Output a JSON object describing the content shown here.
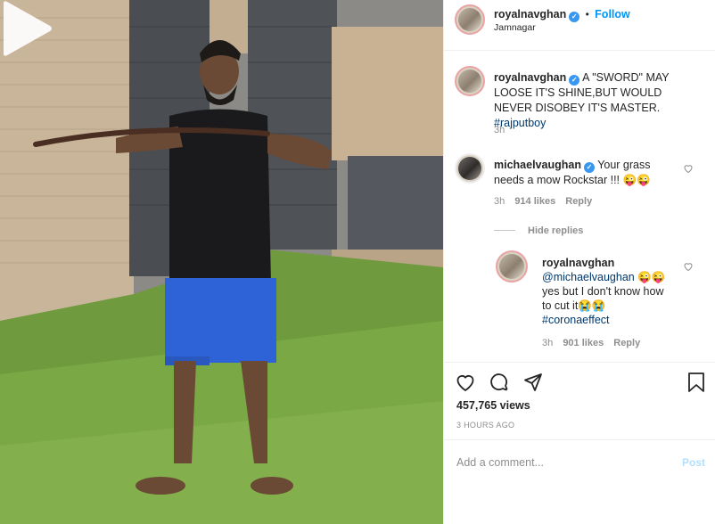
{
  "header": {
    "username": "royalnavghan",
    "follow_label": "Follow",
    "location": "Jamnagar",
    "separator": "•"
  },
  "caption": {
    "username": "royalnavghan",
    "text": "A \"SWORD\" MAY LOOSE IT'S SHINE,BUT WOULD NEVER DISOBEY IT'S MASTER.",
    "hashtag": "#rajputboy",
    "time": "3h"
  },
  "comments": [
    {
      "username": "michaelvaughan",
      "text": "Your grass needs a mow Rockstar !!! 😜😜",
      "time": "3h",
      "likes": "914 likes",
      "reply_label": "Reply"
    }
  ],
  "hide_replies_label": "Hide replies",
  "reply": {
    "username": "royalnavghan",
    "mention": "@michaelvaughan",
    "emoji_after_mention": "😜😜",
    "text": "yes but I don't know how to cut it😭😭",
    "hashtag": "#coronaeffect",
    "time": "3h",
    "likes": "901 likes",
    "reply_label": "Reply"
  },
  "stats": {
    "views": "457,765 views",
    "ago": "3 HOURS AGO"
  },
  "add_comment": {
    "placeholder": "Add a comment...",
    "post_label": "Post"
  },
  "icons": {
    "verified": "verified-badge-icon",
    "like": "heart-icon",
    "comment": "comment-bubble-icon",
    "share": "paper-plane-icon",
    "save": "bookmark-icon",
    "play": "play-icon"
  },
  "colors": {
    "follow": "#0095f6",
    "verified": "#3897f0",
    "hashtag": "#00376b",
    "post_disabled": "#b2dffc"
  }
}
